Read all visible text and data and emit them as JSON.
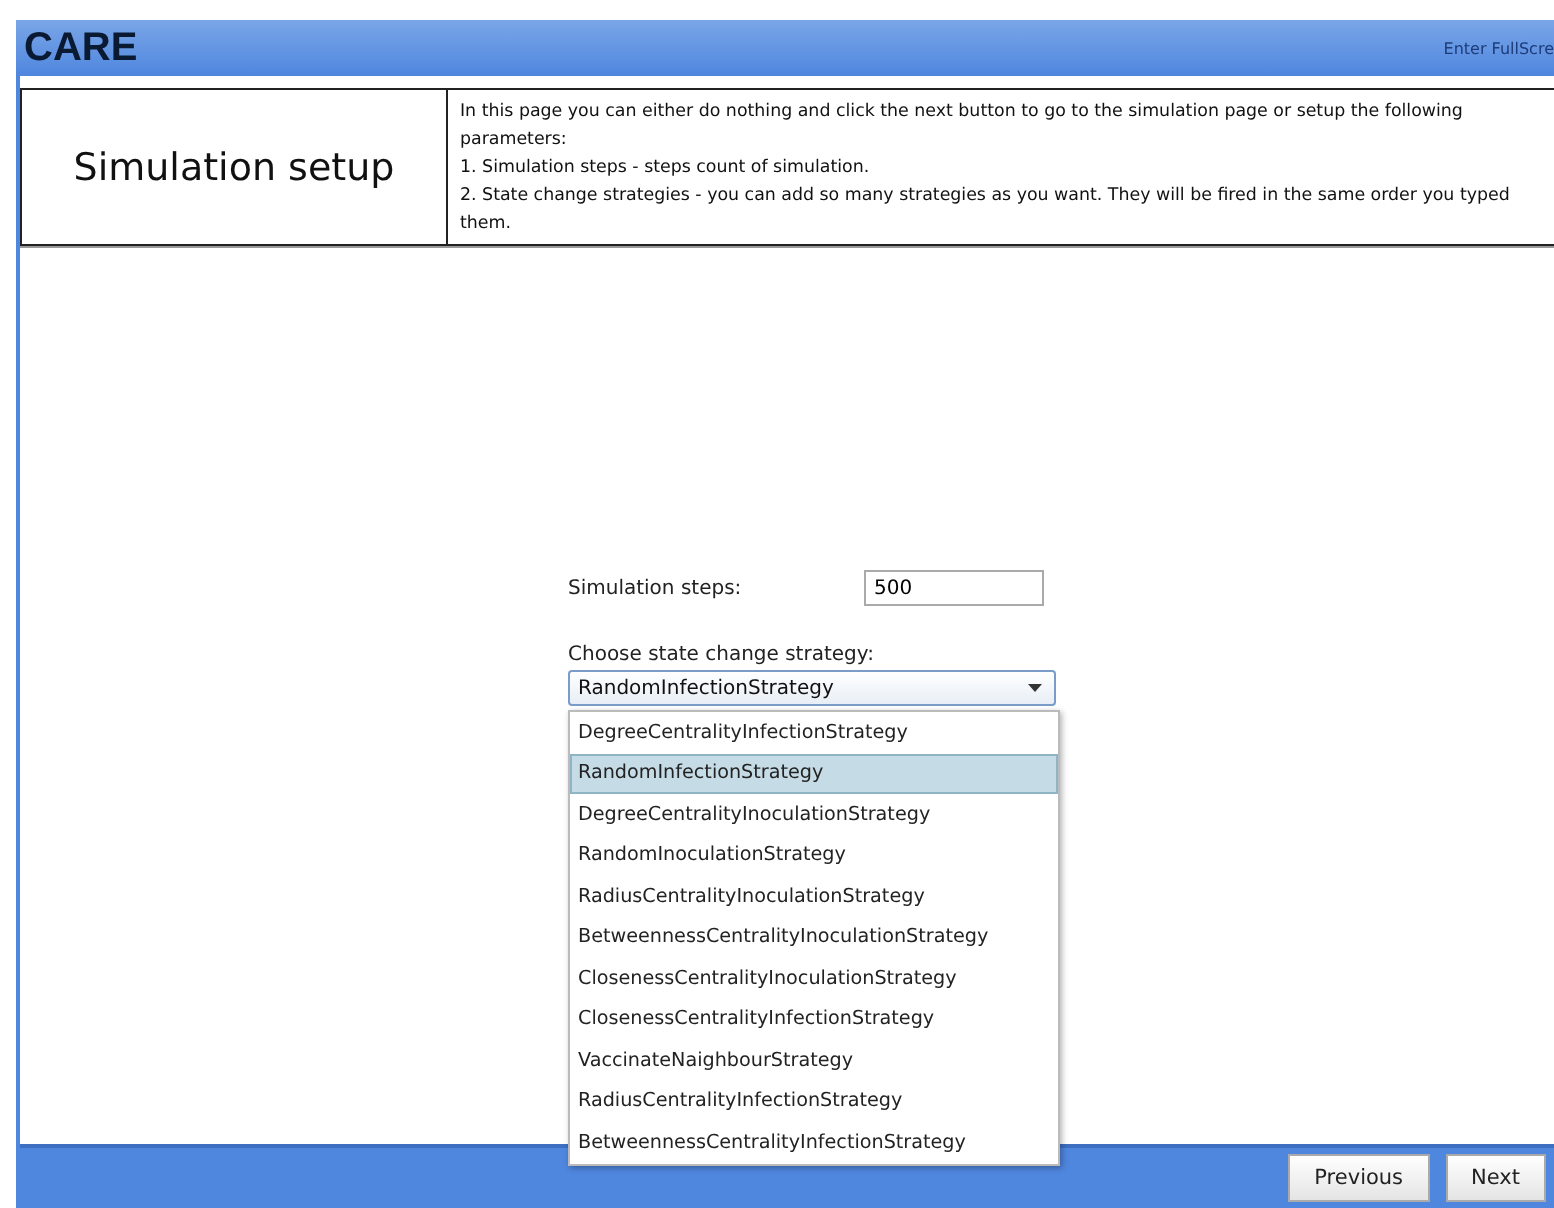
{
  "app": {
    "title": "CARE",
    "fullscreen_link": "Enter FullScre"
  },
  "header": {
    "title": "Simulation setup",
    "description": [
      "In this page you can either do nothing and click the next button to go to the simulation page or setup the following parameters:",
      "1. Simulation steps - steps count of simulation.",
      "2. State change strategies - you can add so many strategies as you want. They will be fired in the same order you typed them."
    ]
  },
  "form": {
    "steps_label": "Simulation steps:",
    "steps_value": "500",
    "strategy_label": "Choose state change strategy:",
    "strategy_value": "RandomInfectionStrategy",
    "dropdown_open": true,
    "options": [
      {
        "label": "DegreeCentralityInfectionStrategy",
        "selected": false
      },
      {
        "label": "RandomInfectionStrategy",
        "selected": true
      },
      {
        "label": "DegreeCentralityInoculationStrategy",
        "selected": false
      },
      {
        "label": "RandomInoculationStrategy",
        "selected": false
      },
      {
        "label": "RadiusCentralityInoculationStrategy",
        "selected": false
      },
      {
        "label": "BetweennessCentralityInoculationStrategy",
        "selected": false
      },
      {
        "label": "ClosenessCentralityInoculationStrategy",
        "selected": false
      },
      {
        "label": "ClosenessCentralityInfectionStrategy",
        "selected": false
      },
      {
        "label": "VaccinateNaighbourStrategy",
        "selected": false
      },
      {
        "label": "RadiusCentralityInfectionStrategy",
        "selected": false
      },
      {
        "label": "BetweennessCentralityInfectionStrategy",
        "selected": false
      }
    ]
  },
  "buttons": [
    "Previous",
    "Next"
  ]
}
